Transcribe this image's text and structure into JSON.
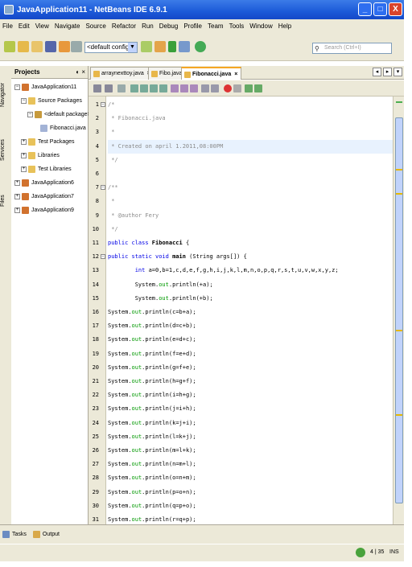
{
  "window": {
    "title": "JavaApplication11 - NetBeans IDE 6.9.1",
    "minimize_label": "_",
    "maximize_label": "□",
    "close_label": "X"
  },
  "menu": [
    "File",
    "Edit",
    "View",
    "Navigate",
    "Source",
    "Refactor",
    "Run",
    "Debug",
    "Profile",
    "Team",
    "Tools",
    "Window",
    "Help"
  ],
  "toolbar": {
    "config_value": "<default config>",
    "search_placeholder": "Search (Ctrl+I)"
  },
  "side_tabs": [
    "Navigator",
    "Services",
    "Files"
  ],
  "projects_panel": {
    "title": "Projects",
    "controls": "◐ ×",
    "tree": [
      {
        "label": "JavaApplication11",
        "expander": "−",
        "icon": "coffee-cup"
      },
      {
        "label": "Source Packages",
        "expander": "−",
        "icon": "folder"
      },
      {
        "label": "<default package>",
        "expander": "−",
        "icon": "package"
      },
      {
        "label": "Fibonacci.java",
        "expander": "",
        "icon": "java-file"
      },
      {
        "label": "Test Packages",
        "expander": "+",
        "icon": "folder"
      },
      {
        "label": "Libraries",
        "expander": "+",
        "icon": "folder"
      },
      {
        "label": "Test Libraries",
        "expander": "+",
        "icon": "folder"
      },
      {
        "label": "JavaApplication6",
        "expander": "+",
        "icon": "coffee-cup"
      },
      {
        "label": "JavaApplication7",
        "expander": "+",
        "icon": "coffee-cup"
      },
      {
        "label": "JavaApplication9",
        "expander": "+",
        "icon": "coffee-cup"
      }
    ]
  },
  "editor_tabs": [
    {
      "label": "arraynexttoy.java",
      "active": false
    },
    {
      "label": "Fibo.java",
      "active": false
    },
    {
      "label": "Fibonacci.java",
      "active": true
    }
  ],
  "tab_close": "×",
  "tab_nav": [
    "◂",
    "▸",
    "▾"
  ],
  "code_lines": [
    {
      "n": "1",
      "fold": "−",
      "parts": [
        {
          "t": "/*",
          "c": "comment"
        }
      ]
    },
    {
      "n": "2",
      "fold": "",
      "parts": [
        {
          "t": " * Fibonacci.java",
          "c": "comment"
        }
      ]
    },
    {
      "n": "3",
      "fold": "",
      "parts": [
        {
          "t": " *",
          "c": "comment"
        }
      ]
    },
    {
      "n": "4",
      "fold": "",
      "parts": [
        {
          "t": " * Created on april 1.2011,08:00PM",
          "c": "comment"
        }
      ]
    },
    {
      "n": "5",
      "fold": "",
      "parts": [
        {
          "t": " */",
          "c": "comment"
        }
      ]
    },
    {
      "n": "6",
      "fold": "",
      "parts": []
    },
    {
      "n": "7",
      "fold": "−",
      "parts": [
        {
          "t": "/**",
          "c": "comment"
        }
      ]
    },
    {
      "n": "8",
      "fold": "",
      "parts": [
        {
          "t": " *",
          "c": "comment"
        }
      ]
    },
    {
      "n": "9",
      "fold": "",
      "parts": [
        {
          "t": " * @author Fery",
          "c": "comment"
        }
      ]
    },
    {
      "n": "10",
      "fold": "",
      "parts": [
        {
          "t": " */",
          "c": "comment"
        }
      ]
    },
    {
      "n": "11",
      "fold": "",
      "parts": [
        {
          "t": "public class ",
          "c": "kw"
        },
        {
          "t": "Fibonacci",
          "c": "bold"
        },
        {
          "t": " {",
          "c": ""
        }
      ]
    },
    {
      "n": "12",
      "fold": "−",
      "parts": [
        {
          "t": "public static void ",
          "c": "kw"
        },
        {
          "t": "main",
          "c": "bold"
        },
        {
          "t": " (String args[]) {",
          "c": ""
        }
      ]
    },
    {
      "n": "13",
      "fold": "",
      "parts": [
        {
          "t": "        int ",
          "c": "kw"
        },
        {
          "t": "a=0,b=1,c,d,e,f,g,h,i,j,k,l,m,n,o,p,q,r,s,t,u,v,w,x,y,z;",
          "c": ""
        }
      ]
    },
    {
      "n": "14",
      "fold": "",
      "parts": [
        {
          "t": "        System.",
          "c": ""
        },
        {
          "t": "out",
          "c": "field"
        },
        {
          "t": ".println(+a);",
          "c": ""
        }
      ]
    },
    {
      "n": "15",
      "fold": "",
      "parts": [
        {
          "t": "        System.",
          "c": ""
        },
        {
          "t": "out",
          "c": "field"
        },
        {
          "t": ".println(+b);",
          "c": ""
        }
      ]
    },
    {
      "n": "16",
      "fold": "",
      "parts": [
        {
          "t": "System.",
          "c": ""
        },
        {
          "t": "out",
          "c": "field"
        },
        {
          "t": ".println(c=b+a);",
          "c": ""
        }
      ]
    },
    {
      "n": "17",
      "fold": "",
      "parts": [
        {
          "t": "System.",
          "c": ""
        },
        {
          "t": "out",
          "c": "field"
        },
        {
          "t": ".println(d=c+b);",
          "c": ""
        }
      ]
    },
    {
      "n": "18",
      "fold": "",
      "parts": [
        {
          "t": "System.",
          "c": ""
        },
        {
          "t": "out",
          "c": "field"
        },
        {
          "t": ".println(e=d+c);",
          "c": ""
        }
      ]
    },
    {
      "n": "19",
      "fold": "",
      "parts": [
        {
          "t": "System.",
          "c": ""
        },
        {
          "t": "out",
          "c": "field"
        },
        {
          "t": ".println(f=e+d);",
          "c": ""
        }
      ]
    },
    {
      "n": "20",
      "fold": "",
      "parts": [
        {
          "t": "System.",
          "c": ""
        },
        {
          "t": "out",
          "c": "field"
        },
        {
          "t": ".println(g=f+e);",
          "c": ""
        }
      ]
    },
    {
      "n": "21",
      "fold": "",
      "parts": [
        {
          "t": "System.",
          "c": ""
        },
        {
          "t": "out",
          "c": "field"
        },
        {
          "t": ".println(h=g+f);",
          "c": ""
        }
      ]
    },
    {
      "n": "22",
      "fold": "",
      "parts": [
        {
          "t": "System.",
          "c": ""
        },
        {
          "t": "out",
          "c": "field"
        },
        {
          "t": ".println(i=h+g);",
          "c": ""
        }
      ]
    },
    {
      "n": "23",
      "fold": "",
      "parts": [
        {
          "t": "System.",
          "c": ""
        },
        {
          "t": "out",
          "c": "field"
        },
        {
          "t": ".println(j=i+h);",
          "c": ""
        }
      ]
    },
    {
      "n": "24",
      "fold": "",
      "parts": [
        {
          "t": "System.",
          "c": ""
        },
        {
          "t": "out",
          "c": "field"
        },
        {
          "t": ".println(k=j+i);",
          "c": ""
        }
      ]
    },
    {
      "n": "25",
      "fold": "",
      "parts": [
        {
          "t": "System.",
          "c": ""
        },
        {
          "t": "out",
          "c": "field"
        },
        {
          "t": ".println(l=k+j);",
          "c": ""
        }
      ]
    },
    {
      "n": "26",
      "fold": "",
      "parts": [
        {
          "t": "System.",
          "c": ""
        },
        {
          "t": "out",
          "c": "field"
        },
        {
          "t": ".println(m=l+k);",
          "c": ""
        }
      ]
    },
    {
      "n": "27",
      "fold": "",
      "parts": [
        {
          "t": "System.",
          "c": ""
        },
        {
          "t": "out",
          "c": "field"
        },
        {
          "t": ".println(n=m+l);",
          "c": ""
        }
      ]
    },
    {
      "n": "28",
      "fold": "",
      "parts": [
        {
          "t": "System.",
          "c": ""
        },
        {
          "t": "out",
          "c": "field"
        },
        {
          "t": ".println(o=n+m);",
          "c": ""
        }
      ]
    },
    {
      "n": "29",
      "fold": "",
      "parts": [
        {
          "t": "System.",
          "c": ""
        },
        {
          "t": "out",
          "c": "field"
        },
        {
          "t": ".println(p=o+n);",
          "c": ""
        }
      ]
    },
    {
      "n": "30",
      "fold": "",
      "parts": [
        {
          "t": "System.",
          "c": ""
        },
        {
          "t": "out",
          "c": "field"
        },
        {
          "t": ".println(q=p+o);",
          "c": ""
        }
      ]
    },
    {
      "n": "31",
      "fold": "",
      "parts": [
        {
          "t": "System.",
          "c": ""
        },
        {
          "t": "out",
          "c": "field"
        },
        {
          "t": ".println(r=q+p);",
          "c": ""
        }
      ]
    }
  ],
  "bottom_tabs": [
    {
      "label": "Tasks",
      "icon": "tasks"
    },
    {
      "label": "Output",
      "icon": "output"
    }
  ],
  "status": {
    "position": "4 | 35",
    "mode": "INS"
  },
  "colors": {
    "titlebar": "#1c5ad8",
    "chrome": "#ece9d8",
    "keyword": "#0000e6",
    "comment": "#8a8a8a",
    "field": "#009900",
    "active_tab_accent": "#f5a623"
  }
}
